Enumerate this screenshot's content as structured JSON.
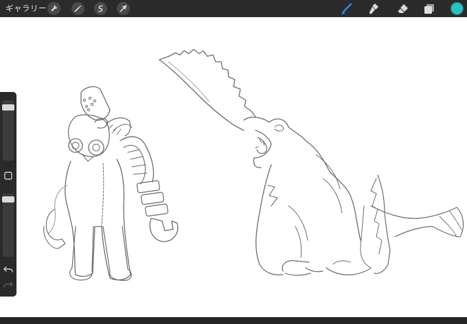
{
  "toolbar": {
    "gallery_label": "ギャラリー",
    "left_tools": [
      "wrench-icon",
      "magic-wand-icon",
      "selection-icon",
      "transform-arrow-icon"
    ],
    "right_tools": [
      "brush-icon",
      "smudge-icon",
      "eraser-icon",
      "layers-icon"
    ],
    "active_tool": "brush-icon",
    "accent_color": "#1e90ff",
    "current_color": "#1fc6c6"
  },
  "sidebar": {
    "brush_size_level": 0.08,
    "opacity_level": 0.05,
    "modify_button": "square-modify-icon",
    "undo": "undo-icon",
    "redo": "redo-icon"
  }
}
